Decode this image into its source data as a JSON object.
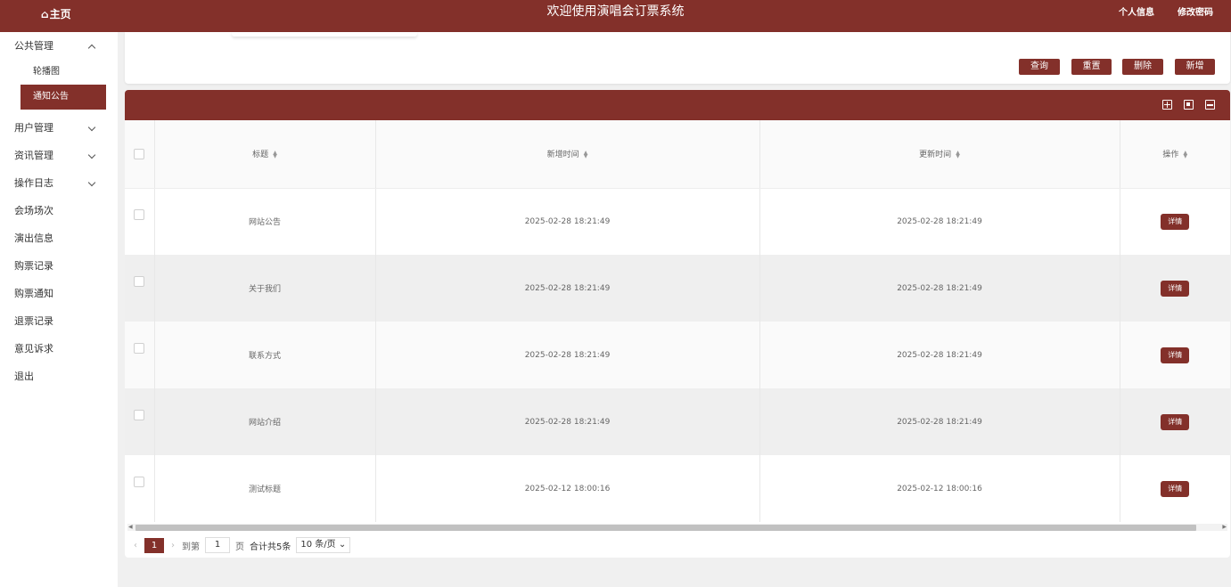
{
  "header": {
    "home_label": "主页",
    "title": "欢迎使用演唱会订票系统",
    "profile_label": "个人信息",
    "change_password_label": "修改密码",
    "brand_color": "#83302a"
  },
  "sidebar": {
    "groups": [
      {
        "label": "公共管理",
        "expanded": true,
        "children": [
          {
            "label": "轮播图",
            "active": false
          },
          {
            "label": "通知公告",
            "active": true
          }
        ]
      },
      {
        "label": "用户管理",
        "expanded": false
      },
      {
        "label": "资讯管理",
        "expanded": false
      },
      {
        "label": "操作日志",
        "expanded": false
      }
    ],
    "items": [
      "会场场次",
      "演出信息",
      "购票记录",
      "购票通知",
      "退票记录",
      "意见诉求",
      "退出"
    ]
  },
  "actions": {
    "query": "查询",
    "reset": "重置",
    "delete": "删除",
    "add": "新增"
  },
  "table": {
    "columns": [
      "标题",
      "新增时间",
      "更新时间",
      "操作"
    ],
    "rows": [
      {
        "title": "网站公告",
        "created": "2025-02-28 18:21:49",
        "updated": "2025-02-28 18:21:49",
        "action": "详情"
      },
      {
        "title": "关于我们",
        "created": "2025-02-28 18:21:49",
        "updated": "2025-02-28 18:21:49",
        "action": "详情"
      },
      {
        "title": "联系方式",
        "created": "2025-02-28 18:21:49",
        "updated": "2025-02-28 18:21:49",
        "action": "详情"
      },
      {
        "title": "网站介绍",
        "created": "2025-02-28 18:21:49",
        "updated": "2025-02-28 18:21:49",
        "action": "详情"
      },
      {
        "title": "测试标题",
        "created": "2025-02-12 18:00:16",
        "updated": "2025-02-12 18:00:16",
        "action": "详情"
      }
    ]
  },
  "pager": {
    "current_page": "1",
    "goto_prefix": "到第",
    "goto_value": "1",
    "goto_suffix": "页",
    "total": "合计共5条",
    "page_size": "10 条/页"
  },
  "icons": {
    "home": "house-icon",
    "toolbar": [
      "column-settings-icon",
      "export-icon",
      "print-icon"
    ],
    "sort": "sort-icon",
    "chevron": [
      "chevron-up-icon",
      "chevron-down-icon"
    ]
  }
}
